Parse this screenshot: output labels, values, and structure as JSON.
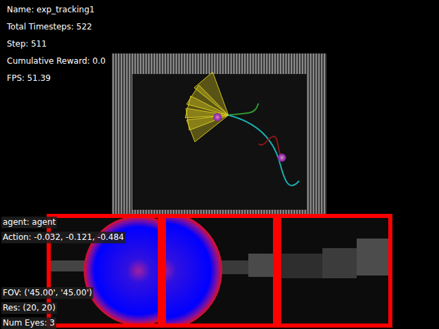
{
  "hud": [
    "Name: exp_tracking1",
    "Total Timesteps: 522",
    "Step: 511",
    "Cumulative Reward: 0.0",
    "FPS: 51.39"
  ],
  "agent_info": [
    "agent: agent",
    "Action: -0.032, -0.121, -0.484"
  ],
  "camera_info": [
    "FOV: ('45.00', '45.00')",
    "Res: (20, 20)",
    "Num Eyes: 3"
  ],
  "eyes": [
    {
      "kind": "target-full"
    },
    {
      "kind": "target-partial"
    },
    {
      "kind": "empty"
    }
  ]
}
